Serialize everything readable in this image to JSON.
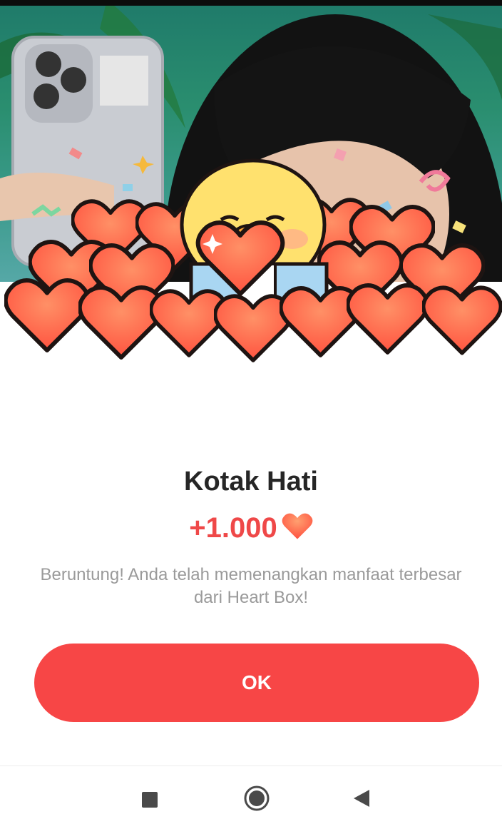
{
  "dialog": {
    "title": "Kotak Hati",
    "reward_amount": "+1.000",
    "reward_icon": "heart-icon",
    "description": "Beruntung! Anda telah memenangkan manfaat terbesar dari Heart Box!",
    "ok_label": "OK"
  },
  "navigation_bar": {
    "buttons": [
      {
        "icon": "recent-apps-icon"
      },
      {
        "icon": "home-icon"
      },
      {
        "icon": "back-icon"
      }
    ]
  },
  "colors": {
    "accent": "#f74646",
    "reward_text": "#ef4848",
    "title_text": "#262626",
    "description_text": "#9a9a9a"
  }
}
